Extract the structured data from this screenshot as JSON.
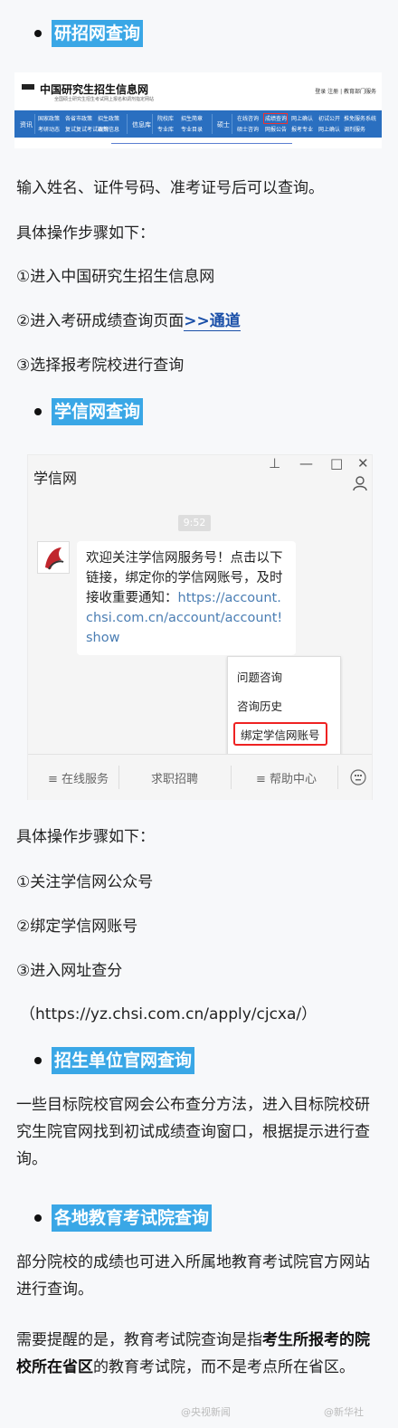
{
  "sections": {
    "s1_title": "研招网查询",
    "s2_title": "学信网查询",
    "s3_title": "招生单位官网查询",
    "s4_title": "各地教育考试院查询"
  },
  "yz_screenshot": {
    "logo_title": "中国研究生招生信息网",
    "logo_sub": "全国硕士研究生招生考试网上报名和调剂指定网站",
    "top_links": "登录  注册  | 教育部门服务",
    "nav": {
      "zixun": "资讯",
      "col1": [
        "国家政策",
        "考研动态"
      ],
      "col2": [
        "各省市政策",
        "复试复试考试政策"
      ],
      "col3": [
        "招生政策",
        "调剂信息"
      ],
      "xinxiku": "信息库",
      "col4": [
        "院校库",
        "专业库"
      ],
      "col5": [
        "招生简章",
        "专业目录"
      ],
      "shuoshi": "硕士",
      "col6": [
        "在线咨询",
        "硕士咨询"
      ],
      "col7": [
        "成绩查询",
        "网报公告"
      ],
      "col8": [
        "网上确认",
        "报考专业"
      ],
      "col9": [
        "初试公开",
        "网上确认"
      ],
      "col10": [
        "推免服务系统",
        "调剂服务"
      ]
    }
  },
  "s1": {
    "desc": "输入姓名、证件号码、准考证号后可以查询。",
    "steps_head": "具体操作步骤如下：",
    "step1": "①进入中国研究生招生信息网",
    "step2": "②进入考研成绩查询页面",
    "step2_link": ">>通道",
    "step3": "③选择报考院校进行查询"
  },
  "wx_screenshot": {
    "title": "学信网",
    "pin": "⊥",
    "minimize": "—",
    "maximize": "□",
    "close": "✕",
    "time": "9:52",
    "msg_1": "欢迎关注学信网服务号！点击以下链接，绑定你的学信网账号，及时接收重要通知：",
    "msg_url": "https://account.chsi.com.cn/account/account!show",
    "menu": [
      "问题咨询",
      "咨询历史",
      "绑定学信网账号"
    ],
    "bar": [
      "≡ 在线服务",
      "求职招聘",
      "≡ 帮助中心"
    ]
  },
  "s2": {
    "steps_head": "具体操作步骤如下：",
    "step1": "①关注学信网公众号",
    "step2": "②绑定学信网账号",
    "step3": "③进入网址查分",
    "url": "（https://yz.chsi.com.cn/apply/cjcxa/）"
  },
  "s3": {
    "desc": "一些目标院校官网会公布查分方法，进入目标院校研究生院官网找到初试成绩查询窗口，根据提示进行查询。"
  },
  "s4": {
    "desc": "部分院校的成绩也可进入所属地教育考试院官方网站进行查询。",
    "note_1": "需要提醒的是，教育考试院查询是指",
    "note_bold": "考生所报考的院校所在省区",
    "note_2": "的教育考试院，而不是考点所在省区。"
  },
  "watermark": {
    "left": "@央视新闻",
    "right": "@新华社"
  }
}
